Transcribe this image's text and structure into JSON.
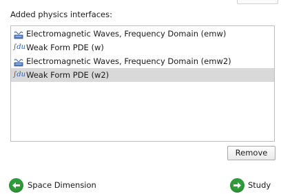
{
  "section_label": "Added physics interfaces:",
  "interfaces": [
    {
      "label": "Electromagnetic Waves, Frequency Domain (emw)",
      "icon": "electromagnetic-waves-icon",
      "selected": false
    },
    {
      "label": "Weak Form PDE (w)",
      "icon": "weak-form-pde-icon",
      "selected": false
    },
    {
      "label": "Electromagnetic Waves, Frequency Domain (emw2)",
      "icon": "electromagnetic-waves-icon",
      "selected": false
    },
    {
      "label": "Weak Form PDE (w2)",
      "icon": "weak-form-pde-icon",
      "selected": true
    }
  ],
  "weak_icon_glyph": "∫du",
  "remove_label": "Remove",
  "nav": {
    "back_label": "Space Dimension",
    "next_label": "Study"
  },
  "colors": {
    "selection": "#d9d9d9",
    "nav_green": "#2e9c3a",
    "icon_blue": "#2a5db0"
  }
}
